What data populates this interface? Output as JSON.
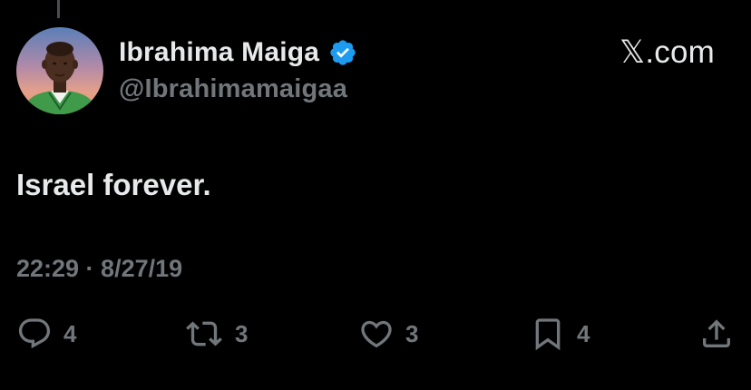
{
  "user": {
    "display_name": "Ibrahima Maiga",
    "handle": "@Ibrahimamaigaa",
    "verified": true
  },
  "source": {
    "label": "𝕏.com"
  },
  "tweet": {
    "text": "Israel forever.",
    "timestamp": "22:29 · 8/27/19"
  },
  "actions": {
    "reply_count": "4",
    "retweet_count": "3",
    "like_count": "3",
    "bookmark_count": "4",
    "icons": [
      "reply-icon",
      "retweet-icon",
      "like-icon",
      "bookmark-icon",
      "share-icon"
    ]
  },
  "colors": {
    "background": "#000000",
    "primary_text": "#e7e9ea",
    "secondary_text": "#71767b",
    "verified_badge": "#1d9bf0"
  }
}
